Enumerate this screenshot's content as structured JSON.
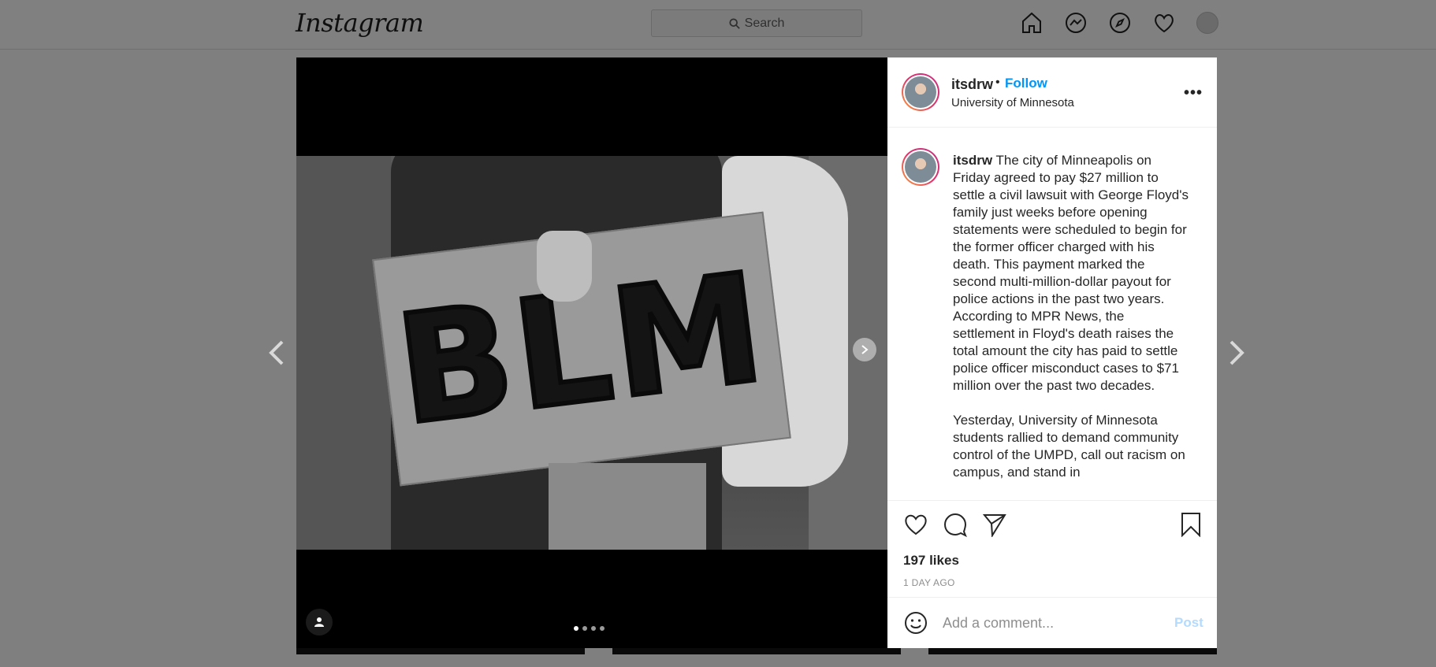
{
  "header": {
    "logo": "Instagram",
    "search_placeholder": "Search"
  },
  "post": {
    "username": "itsdrw",
    "follow_label": "Follow",
    "separator": "•",
    "location": "University of Minnesota",
    "sign_text": "BLM",
    "caption_p1": "The city of Minneapolis on Friday agreed to pay $27 million to settle a civil lawsuit with George Floyd's family just weeks before opening statements were scheduled to begin for the former officer charged with his death. This payment marked the second multi-million-dollar payout for police actions in the past two years. According to MPR News, the settlement in Floyd's death raises the total amount the city has paid to settle police officer misconduct cases to $71 million over the past two decades.",
    "caption_p2": "Yesterday, University of Minnesota students rallied to demand community control of the UMPD, call out racism on campus, and stand in",
    "likes": "197 likes",
    "time_ago": "1 DAY AGO",
    "comment_placeholder": "Add a comment...",
    "post_label": "Post",
    "more_label": "•••",
    "carousel_count": 4,
    "carousel_active": 1
  },
  "colors": {
    "follow": "#0095f6",
    "post_disabled": "#b3dbff",
    "overlay": "#7f7f7f"
  }
}
